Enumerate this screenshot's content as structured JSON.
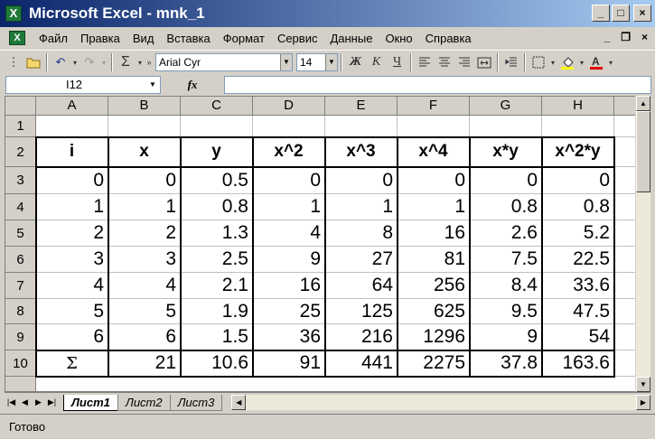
{
  "window": {
    "title": "Microsoft Excel - mnk_1",
    "app_icon": "X",
    "minimize": "_",
    "maximize": "□",
    "close": "×"
  },
  "menu": {
    "items": [
      "Файл",
      "Правка",
      "Вид",
      "Вставка",
      "Формат",
      "Сервис",
      "Данные",
      "Окно",
      "Справка"
    ],
    "doc_min": "_",
    "doc_restore": "❐",
    "doc_close": "×"
  },
  "toolbar": {
    "font_name": "Arial Cyr",
    "font_size": "14",
    "sum_symbol": "Σ",
    "bold": "Ж",
    "italic": "К",
    "underline": "Ч"
  },
  "formula_bar": {
    "name_box": "I12",
    "fx": "fx",
    "formula": ""
  },
  "columns": [
    "A",
    "B",
    "C",
    "D",
    "E",
    "F",
    "G",
    "H"
  ],
  "rows": [
    "1",
    "2",
    "3",
    "4",
    "5",
    "6",
    "7",
    "8",
    "9",
    "10"
  ],
  "table": {
    "header": [
      "i",
      "x",
      "y",
      "x^2",
      "x^3",
      "x^4",
      "x*y",
      "x^2*y"
    ],
    "data": [
      [
        "0",
        "0",
        "0.5",
        "0",
        "0",
        "0",
        "0",
        "0"
      ],
      [
        "1",
        "1",
        "0.8",
        "1",
        "1",
        "1",
        "0.8",
        "0.8"
      ],
      [
        "2",
        "2",
        "1.3",
        "4",
        "8",
        "16",
        "2.6",
        "5.2"
      ],
      [
        "3",
        "3",
        "2.5",
        "9",
        "27",
        "81",
        "7.5",
        "22.5"
      ],
      [
        "4",
        "4",
        "2.1",
        "16",
        "64",
        "256",
        "8.4",
        "33.6"
      ],
      [
        "5",
        "5",
        "1.9",
        "25",
        "125",
        "625",
        "9.5",
        "47.5"
      ],
      [
        "6",
        "6",
        "1.5",
        "36",
        "216",
        "1296",
        "9",
        "54"
      ]
    ],
    "totals": [
      "Σ",
      "21",
      "10.6",
      "91",
      "441",
      "2275",
      "37.8",
      "163.6"
    ]
  },
  "sheets": [
    "Лист1",
    "Лист2",
    "Лист3"
  ],
  "active_sheet": 0,
  "status": "Готово"
}
